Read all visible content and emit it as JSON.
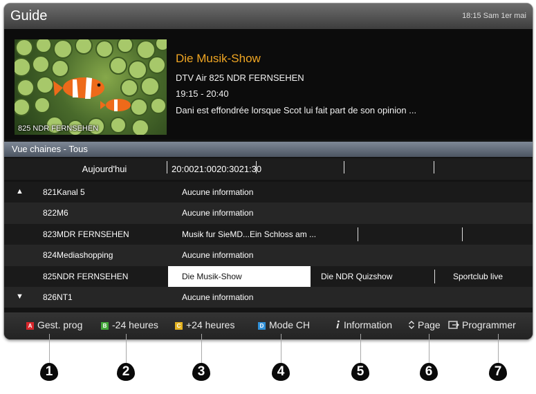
{
  "header": {
    "title": "Guide",
    "clock": "18:15 Sam 1er mai"
  },
  "preview": {
    "thumbnail_caption": "825 NDR FERNSEHEN",
    "program_title": "Die Musik-Show",
    "channel_line": "DTV Air 825 NDR FERNSEHEN",
    "time_line": "19:15 - 20:40",
    "description": "Dani est effondrée lorsque Scot lui fait part de son opinion ..."
  },
  "view_bar": {
    "label": "Vue chaines - Tous"
  },
  "timeline": {
    "today_label": "Aujourd'hui",
    "time_labels": "20:0021:0020:3021:30"
  },
  "channels": [
    {
      "arrow": "▲",
      "name": "821Kanal 5",
      "programs": [
        "Aucune information"
      ]
    },
    {
      "arrow": "",
      "name": "822M6",
      "programs": [
        "Aucune information"
      ]
    },
    {
      "arrow": "",
      "name": "823MDR FERNSEHEN",
      "programs": [
        "Musik fur SieMD...Ein Schloss am ..."
      ]
    },
    {
      "arrow": "",
      "name": "824Mediashopping",
      "programs": [
        "Aucune information"
      ]
    },
    {
      "arrow": "",
      "name": "825NDR FERNSEHEN",
      "programs": [
        "Die Musik-Show",
        "Die NDR Quizshow",
        "Sportclub live"
      ]
    },
    {
      "arrow": "▼",
      "name": "826NT1",
      "programs": [
        "Aucune information"
      ]
    }
  ],
  "footer": {
    "buttons": [
      {
        "key": "A",
        "label": "Gest. prog"
      },
      {
        "key": "B",
        "label": "-24 heures"
      },
      {
        "key": "C",
        "label": "+24 heures"
      },
      {
        "key": "D",
        "label": "Mode CH"
      },
      {
        "key": "",
        "label": "Information"
      },
      {
        "key": "",
        "label": "Page"
      },
      {
        "key": "",
        "label": "Programmer"
      }
    ]
  },
  "callouts": [
    "1",
    "2",
    "3",
    "4",
    "5",
    "6",
    "7"
  ],
  "colors": {
    "key_red": "#d8262b",
    "key_green": "#44a83a",
    "key_yellow": "#e4b21f",
    "key_blue": "#2f8fd7",
    "title_accent": "#f0a623",
    "selected_cell": "#ffffff"
  },
  "icons": {
    "information": "info-i-icon",
    "page": "up-down-chevron-icon",
    "programmer": "schedule-arrow-icon"
  }
}
